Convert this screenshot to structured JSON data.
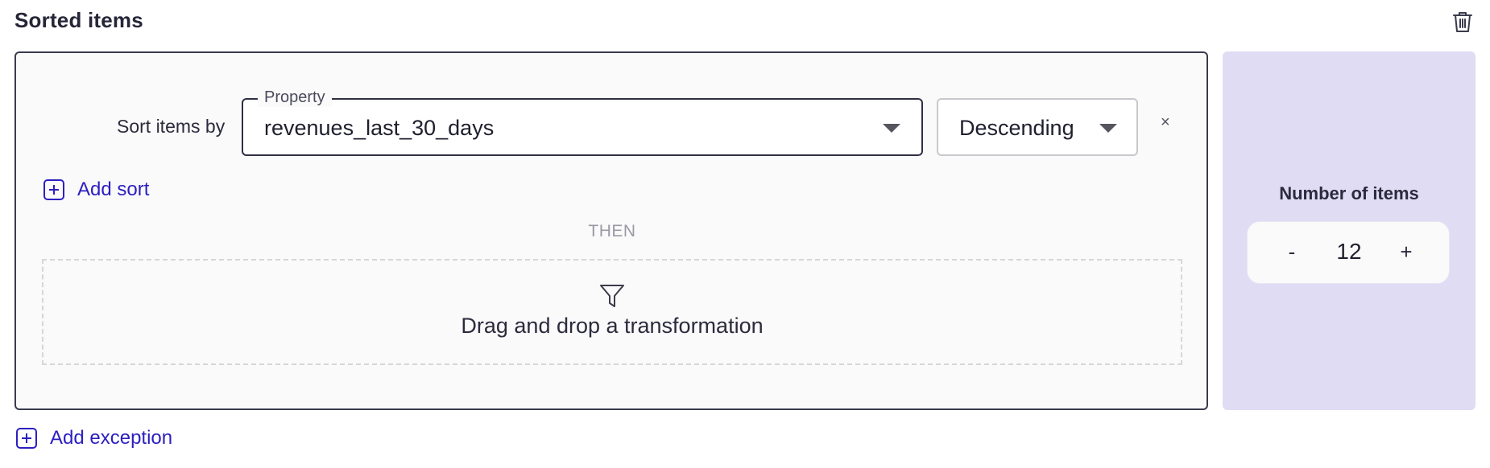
{
  "section": {
    "title": "Sorted items",
    "delete_icon": "trash-icon"
  },
  "sort": {
    "label": "Sort items by",
    "property_legend": "Property",
    "property_value": "revenues_last_30_days",
    "order_value": "Descending",
    "remove_label": "×",
    "add_sort_label": "Add sort"
  },
  "then_label": "THEN",
  "drop_zone": {
    "icon": "funnel-icon",
    "text": "Drag and drop a transformation"
  },
  "count": {
    "label": "Number of items",
    "minus": "-",
    "value": "12",
    "plus": "+"
  },
  "add_exception_label": "Add exception",
  "colors": {
    "accent": "#2c1fc0",
    "count_panel_bg": "#e0dcf4",
    "panel_border": "#3a3a4e"
  }
}
